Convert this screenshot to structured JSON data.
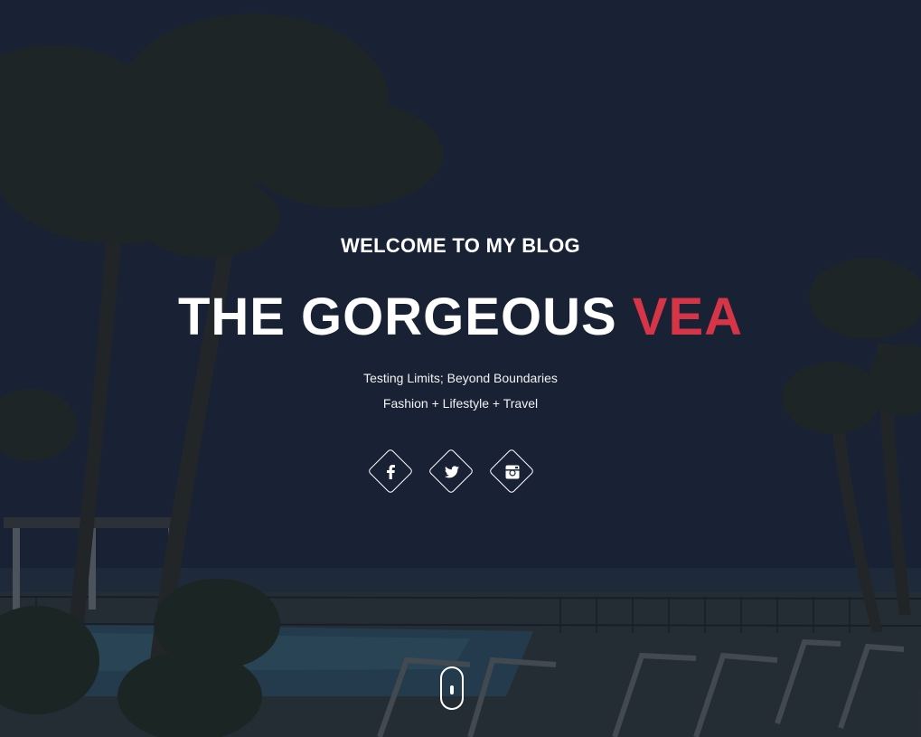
{
  "hero": {
    "welcome": "WELCOME TO MY BLOG",
    "title_main": "THE GORGEOUS",
    "title_accent": "VEA",
    "tagline": "Testing Limits; Beyond Boundaries",
    "categories": "Fashion + Lifestyle + Travel",
    "accent_color": "#d63447"
  },
  "socials": [
    {
      "name": "facebook",
      "icon": "facebook-icon"
    },
    {
      "name": "twitter",
      "icon": "twitter-icon"
    },
    {
      "name": "instagram",
      "icon": "instagram-icon"
    }
  ],
  "scroll": {
    "icon": "mouse-scroll-icon"
  }
}
